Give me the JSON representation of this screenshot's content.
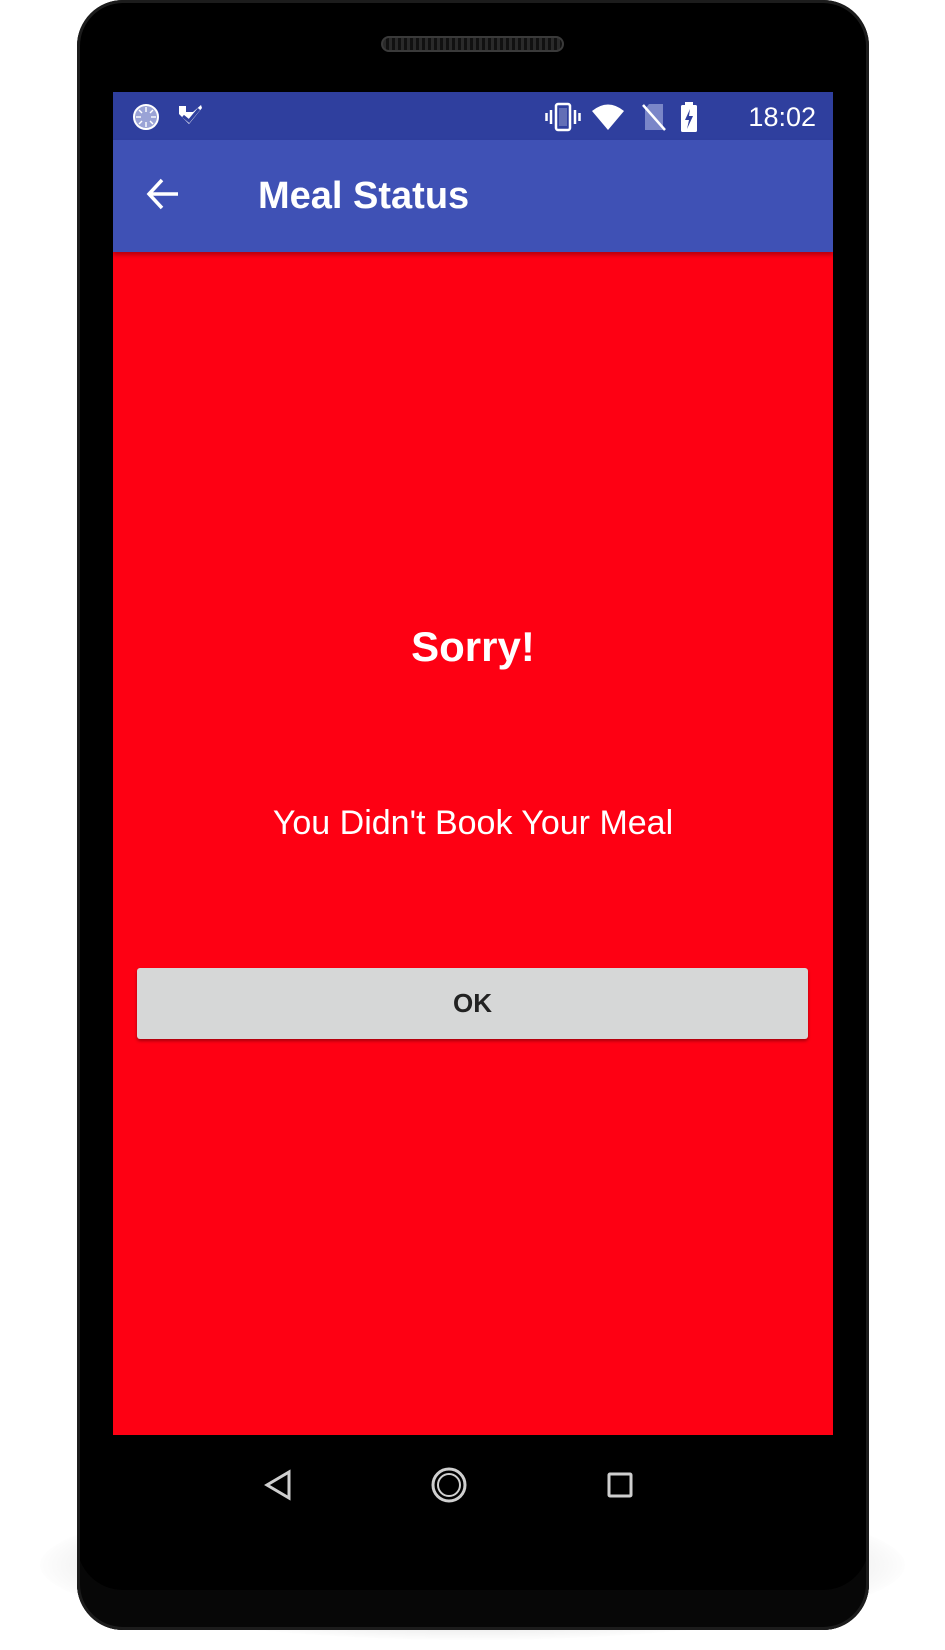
{
  "status_bar": {
    "time": "18:02",
    "icons": [
      "sync-notification-icon",
      "tick-notification-icon",
      "vibrate-icon",
      "wifi-icon",
      "no-sim-icon",
      "battery-charging-icon"
    ]
  },
  "toolbar": {
    "title": "Meal Status",
    "back_icon": "arrow-back-icon"
  },
  "content": {
    "heading": "Sorry!",
    "message": "You Didn't Book Your Meal",
    "ok_label": "OK"
  },
  "nav_bar": {
    "icons": [
      "back-triangle-icon",
      "home-circle-icon",
      "recents-square-icon"
    ]
  },
  "colors": {
    "status_bar": "#2f3f9e",
    "toolbar": "#3f51b5",
    "screen_background": "#fe0013",
    "button": "#d6d7d7",
    "text": "#ffffff"
  }
}
